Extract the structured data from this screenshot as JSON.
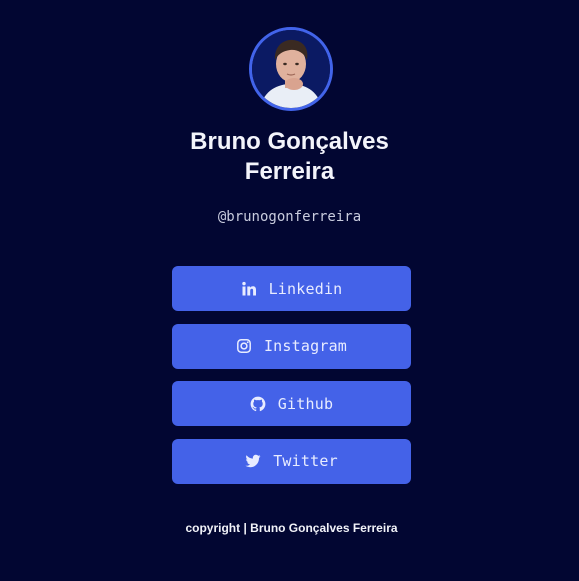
{
  "profile": {
    "name_line1": "Bruno Gonçalves",
    "name_line2": "Ferreira",
    "handle": "@brunogonferreira",
    "avatar_icon": "profile-photo"
  },
  "links": [
    {
      "label": "Linkedin",
      "icon": "linkedin-icon"
    },
    {
      "label": "Instagram",
      "icon": "instagram-icon"
    },
    {
      "label": "Github",
      "icon": "github-icon"
    },
    {
      "label": "Twitter",
      "icon": "twitter-icon"
    }
  ],
  "footer": {
    "text": "copyright | Bruno Gonçalves Ferreira"
  },
  "colors": {
    "background": "#020632",
    "button": "#4462e8",
    "avatar_ring": "#4264ea",
    "text": "#ffffff"
  }
}
